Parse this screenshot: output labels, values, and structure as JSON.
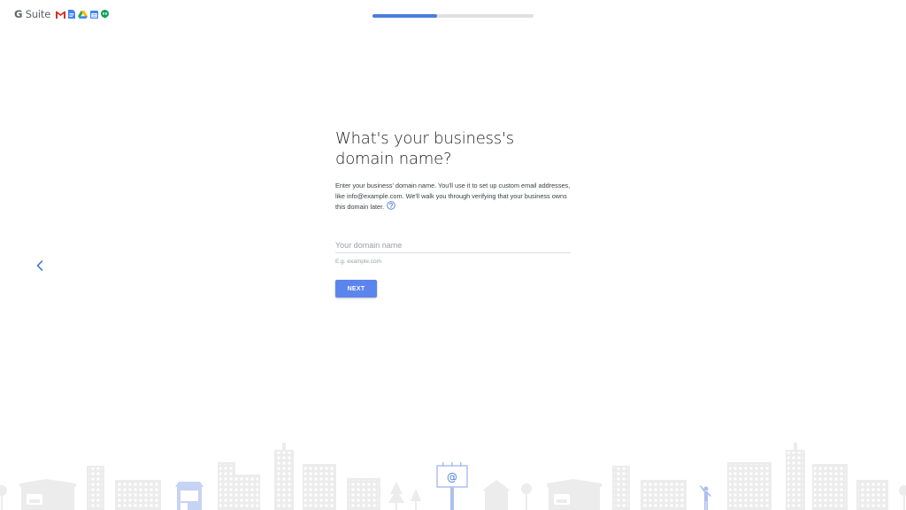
{
  "header": {
    "brand_g": "G",
    "brand_suite": "Suite",
    "app_icons": [
      "gmail-icon",
      "docs-icon",
      "drive-icon",
      "calendar-icon",
      "hangouts-icon"
    ]
  },
  "progress": {
    "fraction": 0.4
  },
  "main": {
    "title": "What's your business's domain name?",
    "description": "Enter your business' domain name. You'll use it to set up custom email addresses, like info@example.com. We'll walk you through verifying that your business owns this domain later.",
    "input_placeholder": "Your domain name",
    "input_value": "",
    "hint": "E.g. example.com",
    "next_label": "NEXT"
  },
  "colors": {
    "accent": "#5b85ec",
    "progress": "#4a7ddf",
    "skyline": "#ececec",
    "skyline_highlight": "#c6d3f4"
  },
  "footer": {
    "billboard_symbol": "@"
  }
}
